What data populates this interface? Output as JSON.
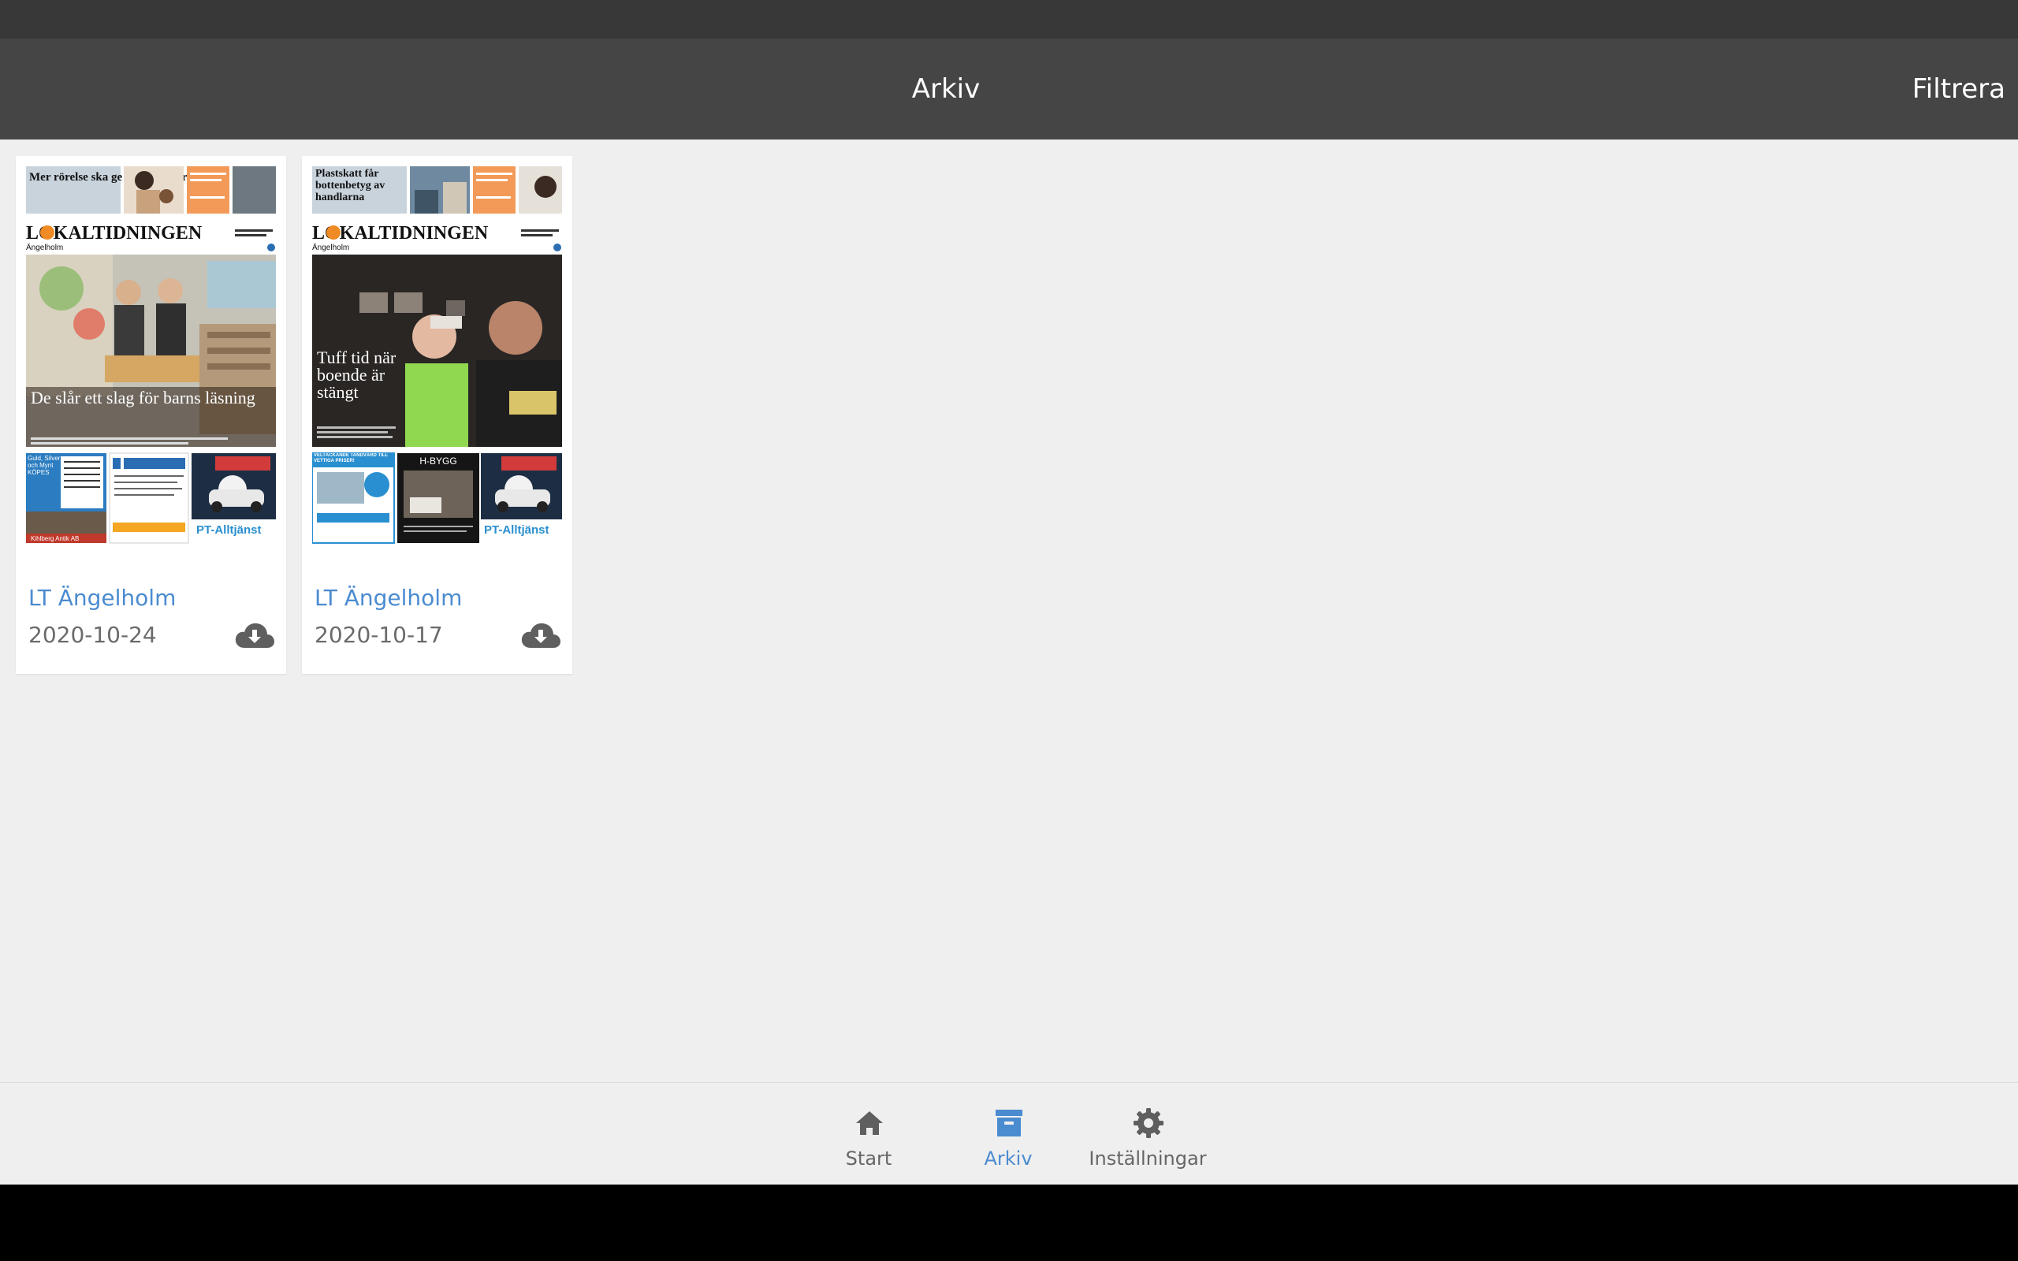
{
  "header": {
    "title": "Arkiv",
    "filter_label": "Filtrera"
  },
  "issues": [
    {
      "name": "LT Ängelholm",
      "date": "2020-10-24",
      "cover": {
        "top_headline": "Mer rörelse ska ge mindre övervikt",
        "masthead": "LOKALTIDNINGEN",
        "edition": "Ängelholm",
        "main_headline": "De slår ett slag för barns läsning",
        "ad_left_title": "Guld, Silver och Mynt KÖPES",
        "ad_left_footer": "Kihlberg Antik AB",
        "ad_right_brand": "PT-Alltjänst"
      }
    },
    {
      "name": "LT Ängelholm",
      "date": "2020-10-17",
      "cover": {
        "top_headline": "Plastskatt får bottenbetyg av handlarna",
        "masthead": "LOKALTIDNINGEN",
        "edition": "Ängelholm",
        "main_headline": "Tuff tid när boende är stängt",
        "ad_left_title": "VELTÄCKANDE TANDVÅRD TILL VETTIGA PRISER!",
        "ad_mid_title": "H-BYGG",
        "ad_right_brand": "PT-Alltjänst"
      }
    }
  ],
  "bottom_nav": [
    {
      "label": "Start",
      "icon": "home-icon",
      "active": false
    },
    {
      "label": "Arkiv",
      "icon": "archive-icon",
      "active": true
    },
    {
      "label": "Inställningar",
      "icon": "gear-icon",
      "active": false
    }
  ],
  "colors": {
    "accent": "#4b8bd0",
    "appbar": "#454545",
    "statusbar": "#383838",
    "background": "#efefef",
    "nav_inactive": "#666666"
  }
}
